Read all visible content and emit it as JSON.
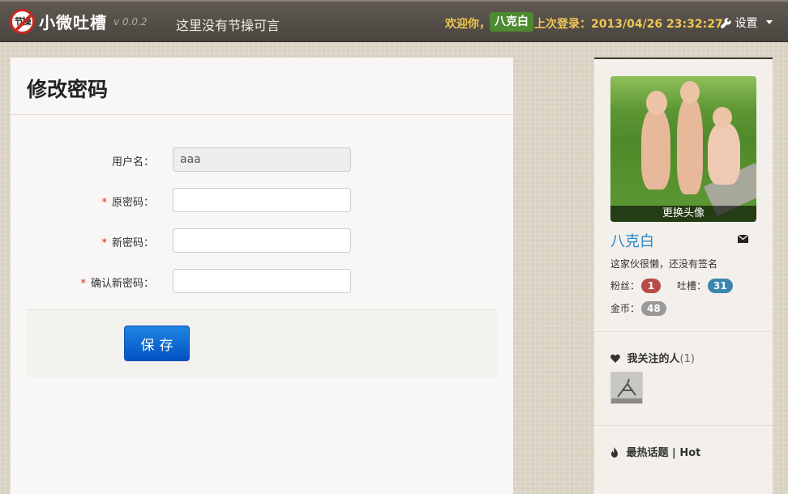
{
  "navbar": {
    "logo_text": "节操",
    "brand_name": "小微吐槽",
    "version": "v 0.0.2",
    "tagline": "这里没有节操可言",
    "welcome_prefix": "欢迎你，",
    "username": "八克白",
    "last_login": "上次登录：2013/04/26 23:32:27",
    "settings_label": "设置"
  },
  "main": {
    "title": "修改密码",
    "fields": [
      {
        "label": "用户名：",
        "required": false,
        "value": "aaa",
        "disabled": true
      },
      {
        "label": "原密码：",
        "required": true,
        "value": ""
      },
      {
        "label": "新密码：",
        "required": true,
        "value": ""
      },
      {
        "label": "确认新密码：",
        "required": true,
        "value": ""
      }
    ],
    "required_mark": "*",
    "save_label": "保存"
  },
  "sidebar": {
    "avatar_caption": "更换头像",
    "username": "八克白",
    "signature": "这家伙很懒，还没有签名",
    "stats": {
      "fans_label": "粉丝：",
      "fans": "1",
      "posts_label": "吐槽：",
      "posts": "31",
      "coins_label": "金币：",
      "coins": "48"
    },
    "following_title": "我关注的人",
    "following_count": "(1)",
    "hot_title": "最热话题 | Hot"
  },
  "colors": {
    "fans_badge": "#b94a48",
    "posts_badge": "#3a87ad",
    "coins_badge": "#999999",
    "accent_link": "#2a87c8",
    "save_button": "#0352c4",
    "required": "#d9231b"
  },
  "icons": {
    "settings": "wrench-icon",
    "mail": "envelope-icon",
    "following": "heart-icon",
    "hot": "fire-icon"
  }
}
